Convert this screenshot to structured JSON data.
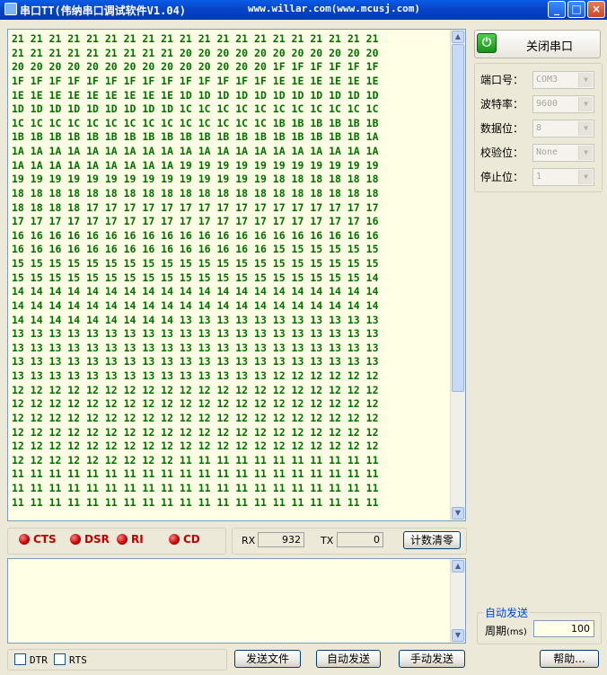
{
  "window": {
    "title": "串口TT(伟纳串口调试软件V1.04)",
    "url": "www.willar.com(www.mcusj.com)",
    "minimize_label": "_",
    "maximize_label": "□",
    "close_label": "×"
  },
  "receive": {
    "text": "21 21 21 21 21 21 21 21 21 21 21 21 21 21 21 21 21 21 21 21\n21 21 21 21 21 21 21 21 21 20 20 20 20 20 20 20 20 20 20 20\n20 20 20 20 20 20 20 20 20 20 20 20 20 20 1F 1F 1F 1F 1F 1F\n1F 1F 1F 1F 1F 1F 1F 1F 1F 1F 1F 1F 1F 1F 1E 1E 1E 1E 1E 1E\n1E 1E 1E 1E 1E 1E 1E 1E 1E 1D 1D 1D 1D 1D 1D 1D 1D 1D 1D 1D\n1D 1D 1D 1D 1D 1D 1D 1D 1D 1C 1C 1C 1C 1C 1C 1C 1C 1C 1C 1C\n1C 1C 1C 1C 1C 1C 1C 1C 1C 1C 1C 1C 1C 1C 1B 1B 1B 1B 1B 1B\n1B 1B 1B 1B 1B 1B 1B 1B 1B 1B 1B 1B 1B 1B 1B 1B 1B 1B 1B 1A\n1A 1A 1A 1A 1A 1A 1A 1A 1A 1A 1A 1A 1A 1A 1A 1A 1A 1A 1A 1A\n1A 1A 1A 1A 1A 1A 1A 1A 1A 19 19 19 19 19 19 19 19 19 19 19\n19 19 19 19 19 19 19 19 19 19 19 19 19 19 18 18 18 18 18 18\n18 18 18 18 18 18 18 18 18 18 18 18 18 18 18 18 18 18 18 18\n18 18 18 18 17 17 17 17 17 17 17 17 17 17 17 17 17 17 17 17\n17 17 17 17 17 17 17 17 17 17 17 17 17 17 17 17 17 17 17 16\n16 16 16 16 16 16 16 16 16 16 16 16 16 16 16 16 16 16 16 16\n16 16 16 16 16 16 16 16 16 16 16 16 16 16 15 15 15 15 15 15\n15 15 15 15 15 15 15 15 15 15 15 15 15 15 15 15 15 15 15 15\n15 15 15 15 15 15 15 15 15 15 15 15 15 15 15 15 15 15 15 14\n14 14 14 14 14 14 14 14 14 14 14 14 14 14 14 14 14 14 14 14\n14 14 14 14 14 14 14 14 14 14 14 14 14 14 14 14 14 14 14 14\n14 14 14 14 14 14 14 14 14 13 13 13 13 13 13 13 13 13 13 13\n13 13 13 13 13 13 13 13 13 13 13 13 13 13 13 13 13 13 13 13\n13 13 13 13 13 13 13 13 13 13 13 13 13 13 13 13 13 13 13 13\n13 13 13 13 13 13 13 13 13 13 13 13 13 13 13 13 13 13 13 13\n13 13 13 13 13 13 13 13 13 13 13 13 13 13 12 12 12 12 12 12\n12 12 12 12 12 12 12 12 12 12 12 12 12 12 12 12 12 12 12 12\n12 12 12 12 12 12 12 12 12 12 12 12 12 12 12 12 12 12 12 12\n12 12 12 12 12 12 12 12 12 12 12 12 12 12 12 12 12 12 12 12\n12 12 12 12 12 12 12 12 12 12 12 12 12 12 12 12 12 12 12 12\n12 12 12 12 12 12 12 12 12 12 12 12 12 12 12 12 12 12 12 12\n12 12 12 12 12 12 12 12 12 11 11 11 11 11 11 11 11 11 11 11\n11 11 11 11 11 11 11 11 11 11 11 11 11 11 11 11 11 11 11 11\n11 11 11 11 11 11 11 11 11 11 11 11 11 11 11 11 11 11 11 11\n11 11 11 11 11 11 11 11 11 11 11 11 11 11 11 11 11 11 11 11"
  },
  "signals": [
    {
      "label": "CTS"
    },
    {
      "label": "DSR"
    },
    {
      "label": "RI"
    },
    {
      "label": "CD"
    }
  ],
  "counters": {
    "rx_label": "RX",
    "rx_value": "932",
    "tx_label": "TX",
    "tx_value": "0",
    "clear_label": "计数清零"
  },
  "control_lines": {
    "dtr_label": "DTR",
    "rts_label": "RTS"
  },
  "actions": {
    "send_file": "发送文件",
    "auto_send": "自动发送",
    "manual_send": "手动发送",
    "help": "帮助..."
  },
  "port": {
    "toggle_label": "关闭串口",
    "power_glyph": "⏻",
    "fields": [
      {
        "label": "端口号：",
        "value": "COM3"
      },
      {
        "label": "波特率：",
        "value": "9600"
      },
      {
        "label": "数据位：",
        "value": "8"
      },
      {
        "label": "校验位：",
        "value": "None"
      },
      {
        "label": "停止位：",
        "value": "1"
      }
    ]
  },
  "auto_send": {
    "group_title": "自动发送",
    "period_label": "周期",
    "period_unit": "(ms)",
    "period_value": "100"
  },
  "colors": {
    "terminal_bg": "#FFFFE6",
    "terminal_text": "#007000",
    "signal_led": "#C00000",
    "titlebar": "#0745C8"
  }
}
